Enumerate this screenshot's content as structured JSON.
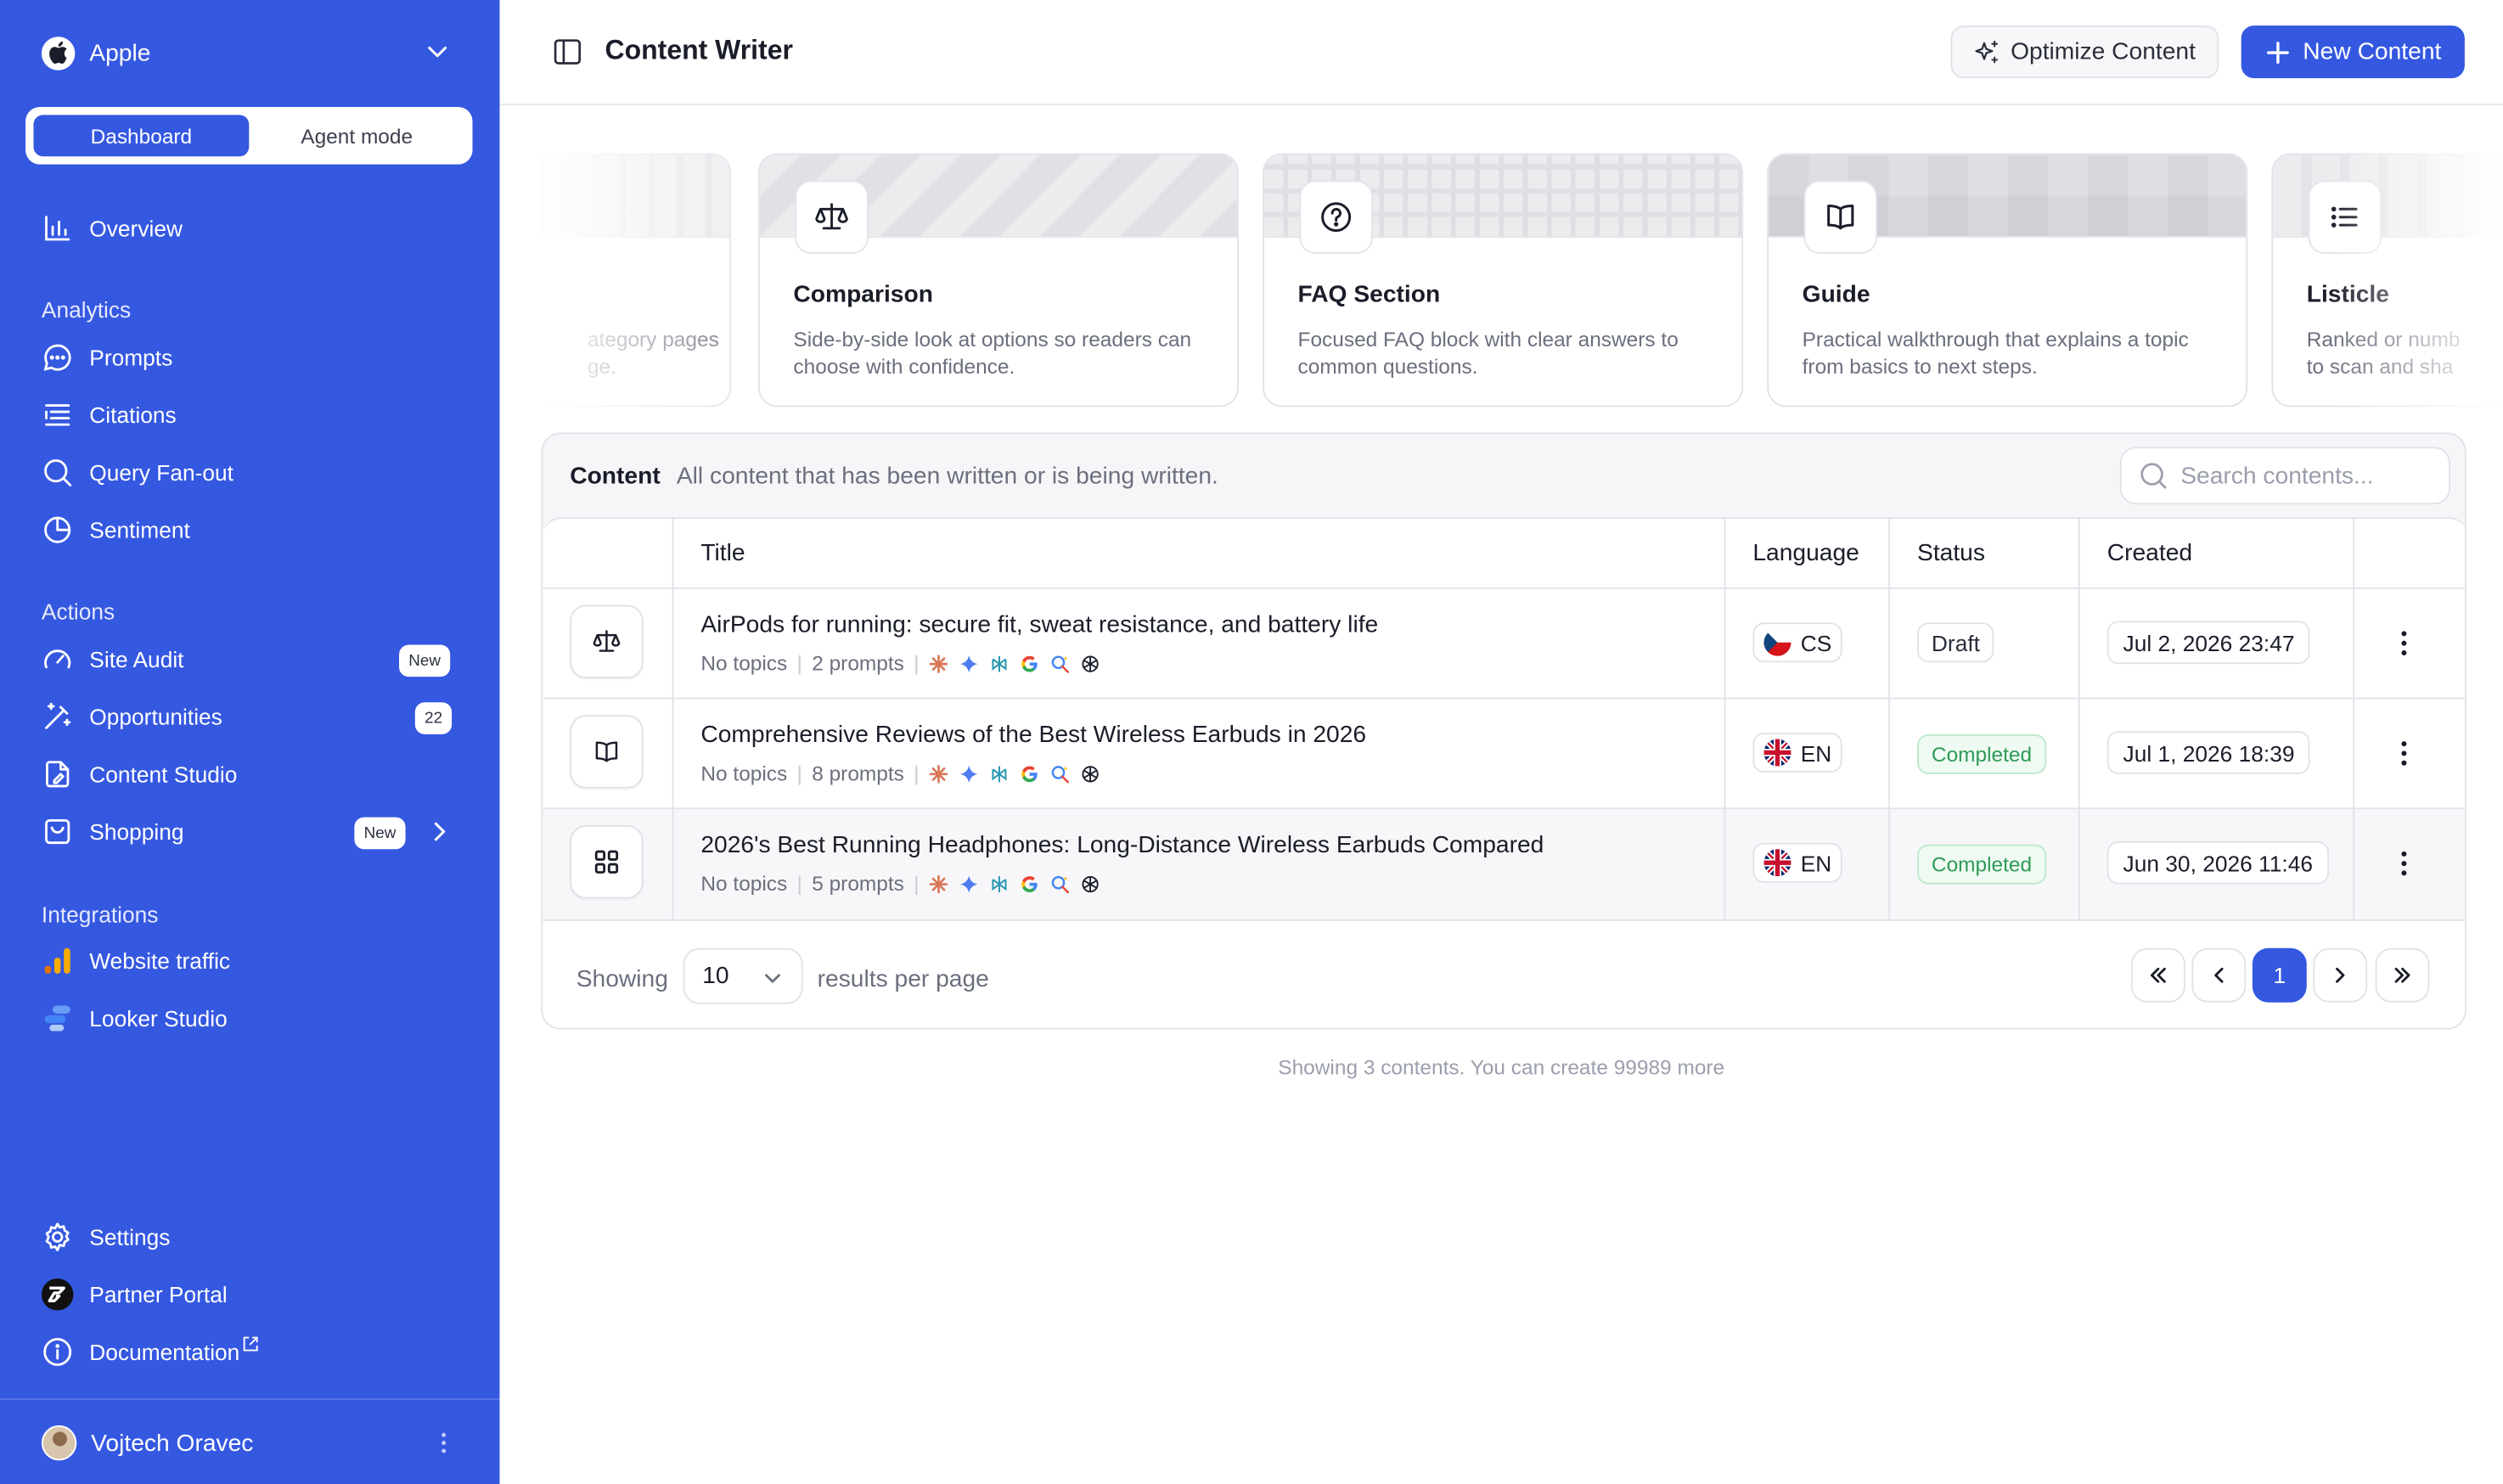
{
  "sidebar": {
    "workspace": "Apple",
    "modes": [
      "Dashboard",
      "Agent mode"
    ],
    "overview": "Overview",
    "analytics_heading": "Analytics",
    "analytics": [
      "Prompts",
      "Citations",
      "Query Fan-out",
      "Sentiment"
    ],
    "actions_heading": "Actions",
    "actions": {
      "site_audit": "Site Audit",
      "site_audit_badge": "New",
      "opportunities": "Opportunities",
      "opportunities_count": "22",
      "content_studio": "Content Studio",
      "shopping": "Shopping",
      "shopping_badge": "New"
    },
    "integrations_heading": "Integrations",
    "integrations": [
      "Website traffic",
      "Looker Studio"
    ],
    "bottom": [
      "Settings",
      "Partner Portal",
      "Documentation"
    ],
    "user": "Vojtech Oravec"
  },
  "header": {
    "title": "Content Writer",
    "optimize_label": "Optimize Content",
    "new_label": "New Content"
  },
  "templates": [
    {
      "title": "",
      "desc": "ategory pages\nge.",
      "icon": "page-icon"
    },
    {
      "title": "Comparison",
      "desc": "Side-by-side look at options so readers can choose with confidence.",
      "icon": "scale-icon"
    },
    {
      "title": "FAQ Section",
      "desc": "Focused FAQ block with clear answers to common questions.",
      "icon": "question-icon"
    },
    {
      "title": "Guide",
      "desc": "Practical walkthrough that explains a topic from basics to next steps.",
      "icon": "book-icon"
    },
    {
      "title": "Listicle",
      "desc": "Ranked or numb\nto scan and sha",
      "icon": "list-icon"
    }
  ],
  "content": {
    "label": "Content",
    "subtitle": "All content that has been written or is being written.",
    "search_placeholder": "Search contents...",
    "columns": [
      "Title",
      "Language",
      "Status",
      "Created"
    ],
    "rows": [
      {
        "icon": "scale-icon",
        "title": "AirPods for running: secure fit, sweat resistance, and battery life",
        "topics": "No topics",
        "prompts": "2 prompts",
        "lang": "CS",
        "status": "Draft",
        "created": "Jul 2, 2026 23:47"
      },
      {
        "icon": "book-icon",
        "title": "Comprehensive Reviews of the Best Wireless Earbuds in 2026",
        "topics": "No topics",
        "prompts": "8 prompts",
        "lang": "EN",
        "status": "Completed",
        "created": "Jul 1, 2026 18:39"
      },
      {
        "icon": "grid-icon",
        "title": "2026's Best Running Headphones: Long-Distance Wireless Earbuds Compared",
        "topics": "No topics",
        "prompts": "5 prompts",
        "lang": "EN",
        "status": "Completed",
        "created": "Jun 30, 2026 11:46"
      }
    ],
    "pagination": {
      "showing": "Showing",
      "per_page": "10",
      "per_page_suffix": "results per page",
      "current_page": "1"
    },
    "footnote": "Showing 3 contents. You can create 99989 more"
  },
  "colors": {
    "brand": "#3558e1",
    "completed": "#2f9b57"
  }
}
